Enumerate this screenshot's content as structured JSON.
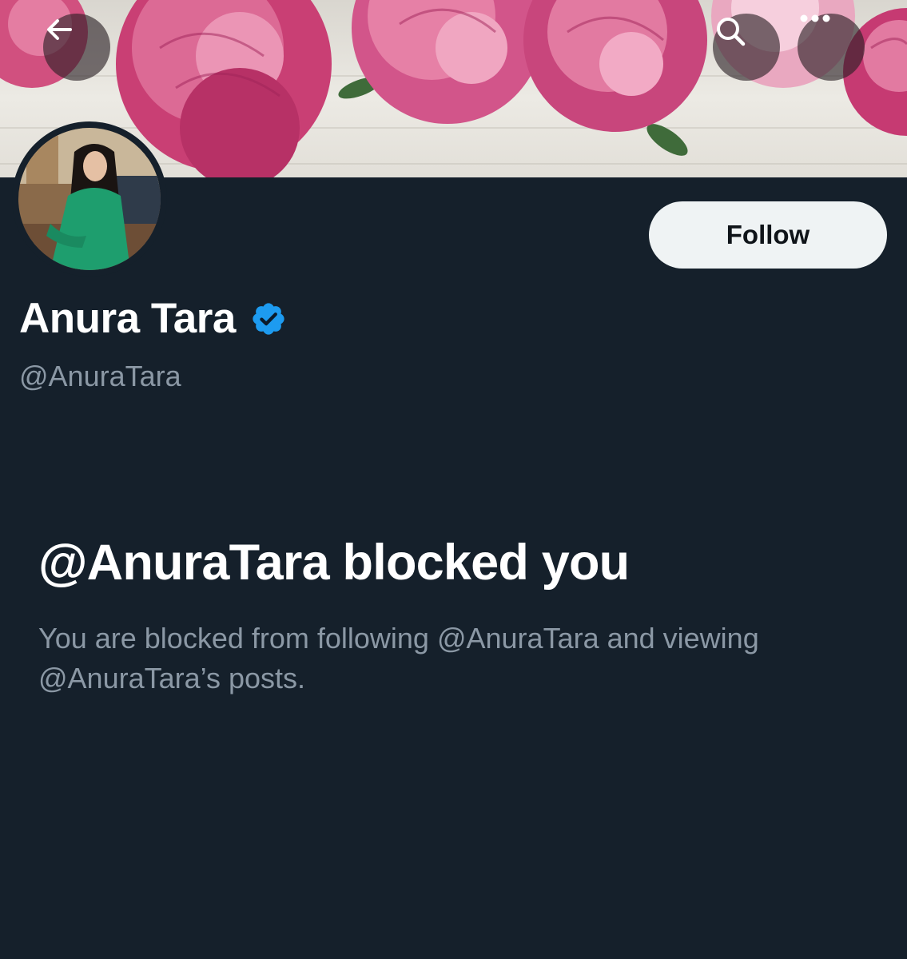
{
  "header": {
    "back_icon": "arrow-left-icon",
    "search_icon": "search-icon",
    "more_icon": "more-horizontal-icon",
    "overlay_button_color": "#3a2a30"
  },
  "profile": {
    "display_name": "Anura Tara",
    "verified": true,
    "verified_badge_color": "#1d9bf0",
    "handle": "@AnuraTara",
    "follow_label": "Follow"
  },
  "blocked_notice": {
    "title": "@AnuraTara blocked you",
    "description": "You are blocked from following @AnuraTara and viewing @AnuraTara’s posts."
  },
  "theme": {
    "background": "#15202b",
    "primary_text": "#ffffff",
    "secondary_text": "#8b98a5",
    "button_bg": "#eff3f4"
  }
}
